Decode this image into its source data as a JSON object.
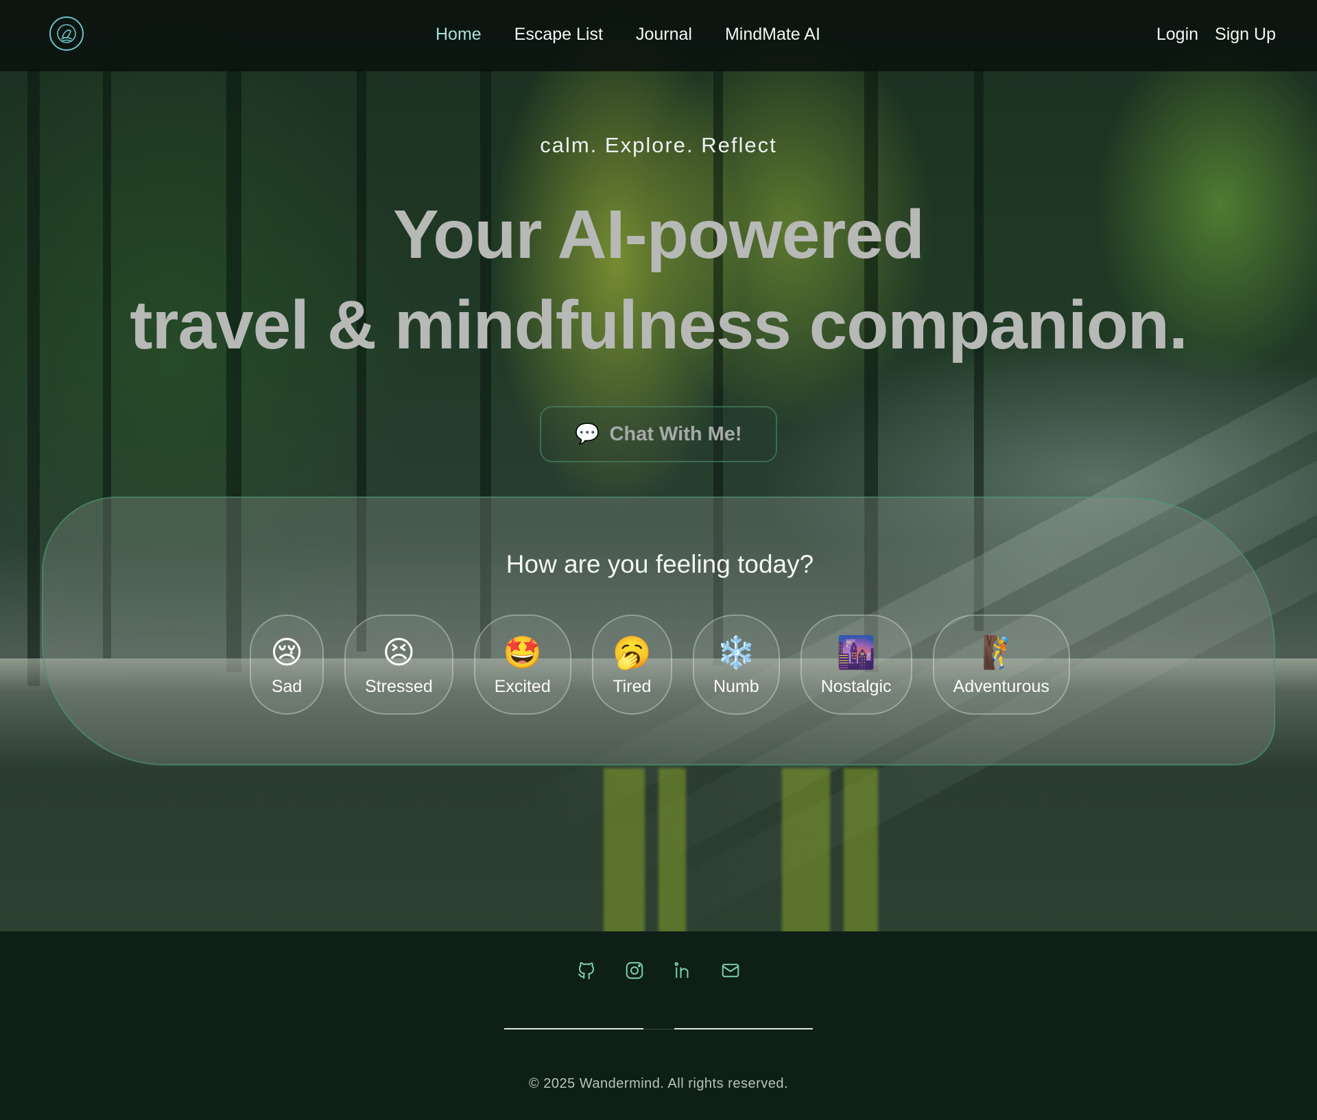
{
  "nav": {
    "links": [
      {
        "label": "Home",
        "active": true
      },
      {
        "label": "Escape List",
        "active": false
      },
      {
        "label": "Journal",
        "active": false
      },
      {
        "label": "MindMate AI",
        "active": false
      }
    ],
    "login_label": "Login",
    "signup_label": "Sign Up",
    "logo_icon": "brain-tree-icon"
  },
  "hero": {
    "tagline": "calm. Explore. Reflect",
    "headline_line1": "Your AI-powered",
    "headline_line2": "travel & mindfulness companion.",
    "chat_button_icon": "💬",
    "chat_button_label": "Chat With Me!"
  },
  "mood": {
    "title": "How are you feeling today?",
    "options": [
      {
        "emoji": "😢",
        "label": "Sad"
      },
      {
        "emoji": "😣",
        "label": "Stressed"
      },
      {
        "emoji": "🤩",
        "label": "Excited"
      },
      {
        "emoji": "🥱",
        "label": "Tired"
      },
      {
        "emoji": "❄️",
        "label": "Numb"
      },
      {
        "emoji": "🌆",
        "label": "Nostalgic"
      },
      {
        "emoji": "🧗",
        "label": "Adventurous"
      }
    ]
  },
  "footer": {
    "social_icons": [
      "github-icon",
      "instagram-icon",
      "linkedin-icon",
      "mail-icon"
    ],
    "copyright": "© 2025 Wandermind. All rights reserved."
  },
  "colors": {
    "accent": "#a8e0d8",
    "card_border": "#46966e",
    "footer_bg": "#0d1f16",
    "icon": "#7fd0b0"
  }
}
